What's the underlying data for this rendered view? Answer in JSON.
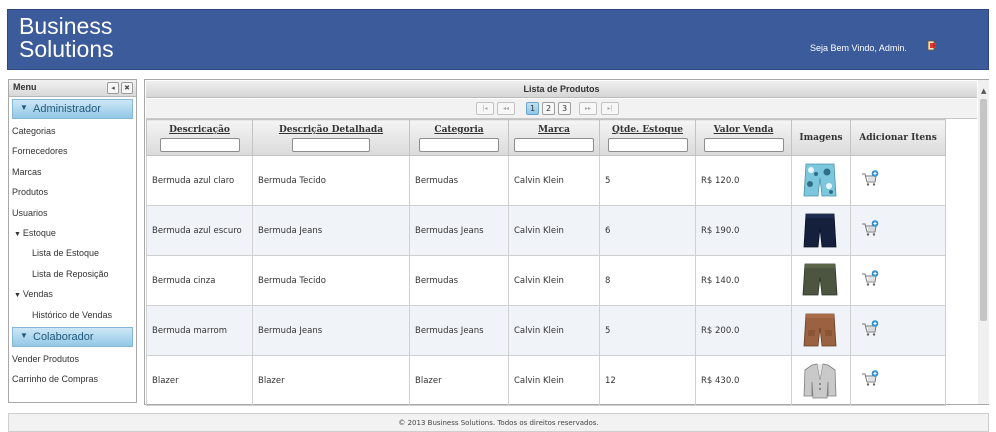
{
  "header": {
    "brand_line1": "Business",
    "brand_line2": "Solutions",
    "welcome": "Seja Bem Vindo, Admin.",
    "logout_icon": "logout-icon"
  },
  "sidebar": {
    "title": "Menu",
    "groups": [
      {
        "title": "Administrador",
        "items": [
          {
            "label": "Categorias"
          },
          {
            "label": "Fornecedores"
          },
          {
            "label": "Marcas"
          },
          {
            "label": "Produtos"
          },
          {
            "label": "Usuarios"
          },
          {
            "label": "Estoque"
          },
          {
            "label": "Lista de Estoque"
          },
          {
            "label": "Lista de Reposição"
          },
          {
            "label": "Vendas"
          },
          {
            "label": "Histórico de Vendas"
          }
        ]
      },
      {
        "title": "Colaborador",
        "items": [
          {
            "label": "Vender Produtos"
          },
          {
            "label": "Carrinho de Compras"
          }
        ]
      }
    ]
  },
  "grid": {
    "title": "Lista de Produtos",
    "pager": {
      "first": "|◂",
      "prev": "◂◂",
      "pages": [
        "1",
        "2",
        "3"
      ],
      "current_page": "1",
      "next": "▸▸",
      "last": "▸|"
    },
    "columns": [
      "Descricação",
      "Descrição Detalhada",
      "Categoria",
      "Marca",
      "Qtde. Estoque",
      "Valor Venda",
      "Imagens",
      "Adicionar Itens"
    ],
    "rows": [
      {
        "descricao": "Bermuda azul claro",
        "detalhada": "Bermuda Tecido",
        "categoria": "Bermudas",
        "marca": "Calvin Klein",
        "estoque": "5",
        "valor": "R$ 120.0",
        "image": "floral-shorts"
      },
      {
        "descricao": "Bermuda azul escuro",
        "detalhada": "Bermuda Jeans",
        "categoria": "Bermudas Jeans",
        "marca": "Calvin Klein",
        "estoque": "6",
        "valor": "R$ 190.0",
        "image": "navy-shorts"
      },
      {
        "descricao": "Bermuda cinza",
        "detalhada": "Bermuda Tecido",
        "categoria": "Bermudas",
        "marca": "Calvin Klein",
        "estoque": "8",
        "valor": "R$ 140.0",
        "image": "olive-shorts"
      },
      {
        "descricao": "Bermuda marrom",
        "detalhada": "Bermuda Jeans",
        "categoria": "Bermudas Jeans",
        "marca": "Calvin Klein",
        "estoque": "5",
        "valor": "R$ 200.0",
        "image": "brown-shorts"
      },
      {
        "descricao": "Blazer",
        "detalhada": "Blazer",
        "categoria": "Blazer",
        "marca": "Calvin Klein",
        "estoque": "12",
        "valor": "R$ 430.0",
        "image": "gray-blazer"
      }
    ]
  },
  "footer": {
    "text": "© 2013 Business Solutions. Todos os direitos reservados."
  },
  "colors": {
    "header_bg": "#3c5b9b",
    "menu_group_bg": "#a9d4ec",
    "alt_row_bg": "#f0f4f9"
  }
}
